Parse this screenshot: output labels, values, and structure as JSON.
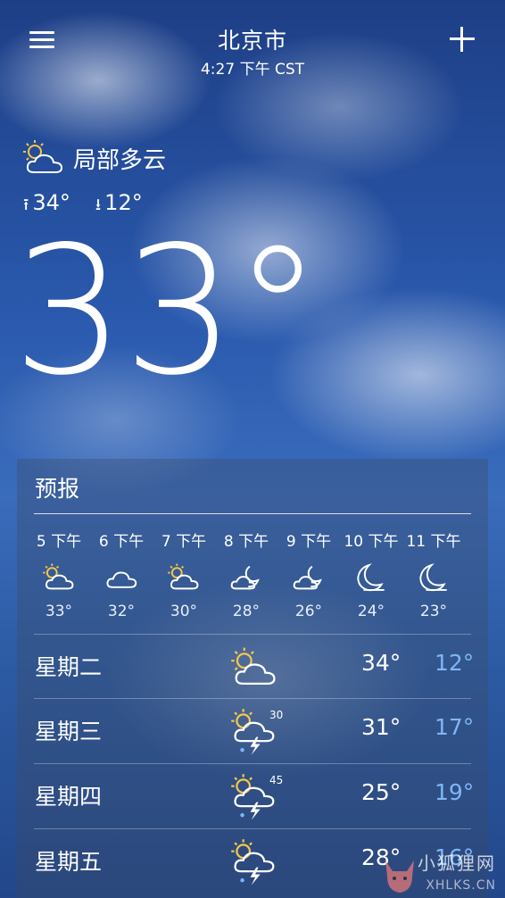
{
  "header": {
    "city": "北京市",
    "time": "4:27 下午 CST"
  },
  "current": {
    "condition": "局部多云",
    "high": "34°",
    "low": "12°",
    "temperature": "33°",
    "icon": "partly-cloudy-icon"
  },
  "forecast": {
    "title": "预报",
    "hourly": [
      {
        "time": "5 下午",
        "icon": "partly-cloudy-icon",
        "temp": "33°"
      },
      {
        "time": "6 下午",
        "icon": "cloudy-icon",
        "temp": "32°"
      },
      {
        "time": "7 下午",
        "icon": "partly-cloudy-icon",
        "temp": "30°"
      },
      {
        "time": "8 下午",
        "icon": "night-cloudy-icon",
        "temp": "28°"
      },
      {
        "time": "9 下午",
        "icon": "night-cloudy-icon",
        "temp": "26°"
      },
      {
        "time": "10 下午",
        "icon": "night-clear-icon",
        "temp": "24°"
      },
      {
        "time": "11 下午",
        "icon": "night-clear-icon",
        "temp": "23°"
      }
    ],
    "daily": [
      {
        "day": "星期二",
        "icon": "partly-cloudy-icon",
        "pop": "",
        "high": "34°",
        "low": "12°"
      },
      {
        "day": "星期三",
        "icon": "thunderstorm-icon",
        "pop": "30",
        "high": "31°",
        "low": "17°"
      },
      {
        "day": "星期四",
        "icon": "thunderstorm-icon",
        "pop": "45",
        "high": "25°",
        "low": "19°"
      },
      {
        "day": "星期五",
        "icon": "thunderstorm-icon",
        "pop": "",
        "high": "28°",
        "low": "16°"
      }
    ]
  },
  "watermark": {
    "line1": "小狐狸网",
    "line2": "XHLKS.CN"
  },
  "colors": {
    "low_temp": "#7fb6f3",
    "sun": "#f5c84a"
  }
}
